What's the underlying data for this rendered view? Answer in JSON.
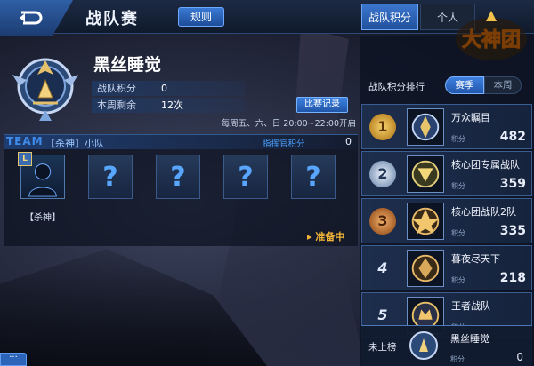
{
  "header": {
    "title": "战队赛",
    "rules_label": "规则"
  },
  "profile": {
    "team_name": "黑丝睡觉",
    "stats": [
      {
        "label": "战队积分",
        "value": "0"
      },
      {
        "label": "本周剩余",
        "value": "12次"
      }
    ],
    "record_label": "比赛记录",
    "schedule": "每周五、六、日 20:00~22:00开启"
  },
  "squad": {
    "tag": "TEAM",
    "subtitle": "【杀神】小队",
    "commander_label": "指挥官积分",
    "commander_value": "0",
    "member_badge": "L",
    "member_name": "【杀神】",
    "empty_slot": "?",
    "ready": "▸ 准备中"
  },
  "chat": {
    "label": "···"
  },
  "right_panel": {
    "tabs": [
      {
        "label": "战队积分",
        "active": true
      },
      {
        "label": "个人"
      }
    ],
    "logo_text": "大神团",
    "ranking_title": "战队积分排行",
    "periods": [
      {
        "label": "赛季",
        "active": true
      },
      {
        "label": "本周"
      }
    ],
    "ranks": [
      {
        "rank": "1",
        "name": "万众瞩目",
        "score_label": "积分",
        "score": "482",
        "medal": "gold"
      },
      {
        "rank": "2",
        "name": "核心团专属战队",
        "score_label": "积分",
        "score": "359",
        "medal": "silver"
      },
      {
        "rank": "3",
        "name": "核心团战队2队",
        "score_label": "积分",
        "score": "335",
        "medal": "bronze"
      },
      {
        "rank": "4",
        "name": "暮夜尽天下",
        "score_label": "积分",
        "score": "218",
        "medal": "none"
      },
      {
        "rank": "5",
        "name": "王者战队",
        "score_label": "积分",
        "score": "",
        "medal": "none"
      }
    ],
    "me": {
      "status": "未上榜",
      "name": "黑丝睡觉",
      "score_label": "积分",
      "score": "0"
    }
  },
  "colors": {
    "accent": "#3a7ad4",
    "gold": "#f2b437",
    "text": "#e6eefb"
  }
}
